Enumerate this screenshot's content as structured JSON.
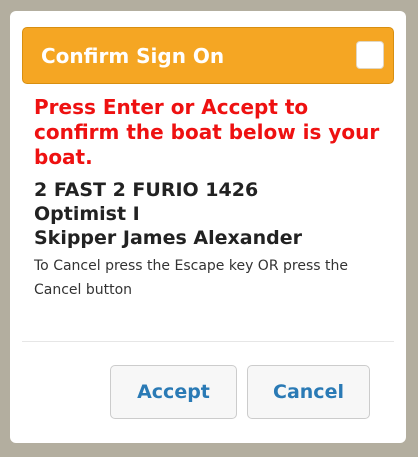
{
  "dialog": {
    "title": "Confirm Sign On",
    "warning": "Press Enter or Accept to confirm the boat below is your boat.",
    "boat": {
      "name": "2 FAST 2 FURIO 1426",
      "class": "Optimist I",
      "skipper": "Skipper James Alexander"
    },
    "instructions": "To Cancel press the Escape key OR press the Cancel button",
    "buttons": {
      "accept": "Accept",
      "cancel": "Cancel"
    }
  },
  "colors": {
    "header": "#f5a623",
    "warning": "#ee1111",
    "button_text": "#2a7ab5",
    "backdrop": "#b3ae9f"
  }
}
